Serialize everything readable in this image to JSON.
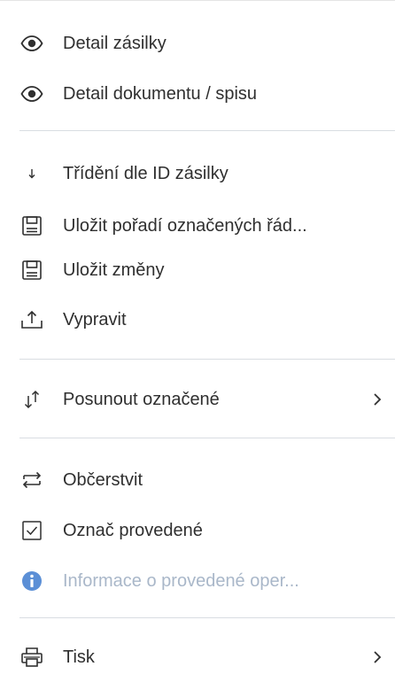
{
  "menu": {
    "items": [
      {
        "label": "Detail zásilky",
        "icon": "eye-icon"
      },
      {
        "label": "Detail dokumentu / spisu",
        "icon": "eye-icon"
      },
      {
        "label": "Třídění dle ID zásilky",
        "icon": "arrow-down-icon"
      },
      {
        "label": "Uložit pořadí označených řád...",
        "icon": "save-icon"
      },
      {
        "label": "Uložit změny",
        "icon": "save-icon"
      },
      {
        "label": "Vypravit",
        "icon": "upload-icon"
      },
      {
        "label": "Posunout označené",
        "icon": "move-icon",
        "submenu": true
      },
      {
        "label": "Občerstvit",
        "icon": "refresh-icon"
      },
      {
        "label": "Označ provedené",
        "icon": "checkbox-icon"
      },
      {
        "label": "Informace o provedené oper...",
        "icon": "info-icon",
        "disabled": true
      },
      {
        "label": "Tisk",
        "icon": "print-icon",
        "submenu": true
      }
    ]
  },
  "colors": {
    "text": "#2f2f2f",
    "disabled_text": "#a9b7c9",
    "info_icon": "#5b8fd6",
    "divider": "#d9dde2"
  }
}
